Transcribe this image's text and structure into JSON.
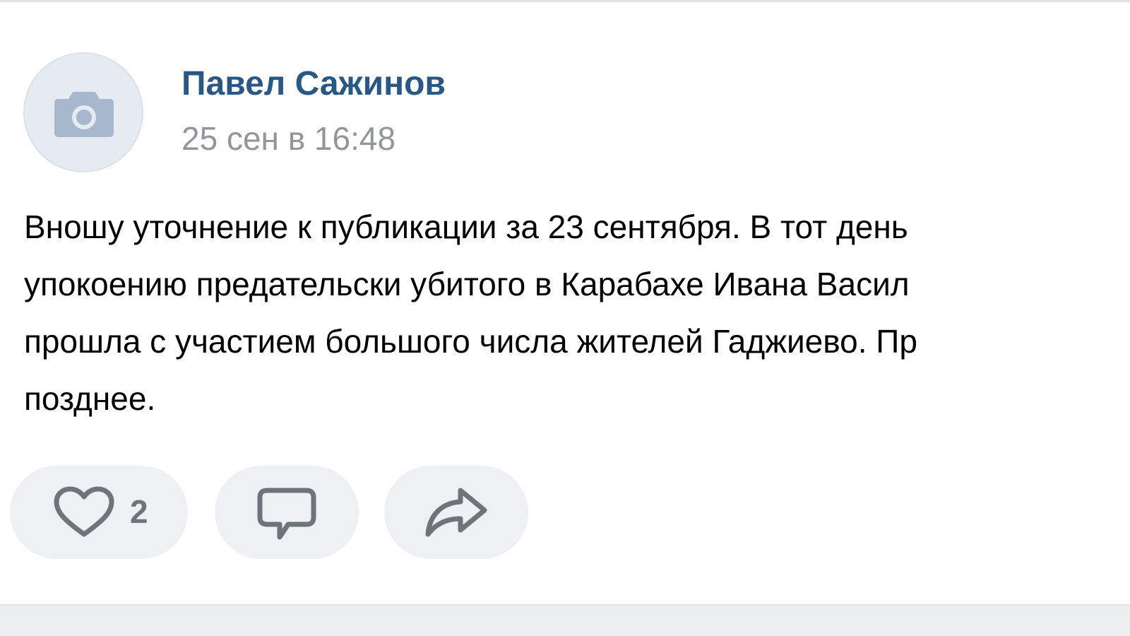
{
  "post": {
    "author": "Павел Сажинов",
    "date": "25 сен в 16:48",
    "text_lines": [
      "Вношу уточнение к публикации за 23 сентября. В тот день",
      "упокоению предательски убитого в Карабахе Ивана Васил",
      "прошла с участием большого числа жителей Гаджиево. Пр",
      "позднее."
    ]
  },
  "actions": {
    "like_count": "2",
    "icons": {
      "like": "heart-icon",
      "comment": "comment-bubble-icon",
      "share": "share-arrow-icon",
      "avatar": "camera-icon"
    }
  },
  "colors": {
    "author": "#2a5885",
    "date": "#939699",
    "button_bg": "#eef0f3",
    "icon": "#6e747a"
  }
}
